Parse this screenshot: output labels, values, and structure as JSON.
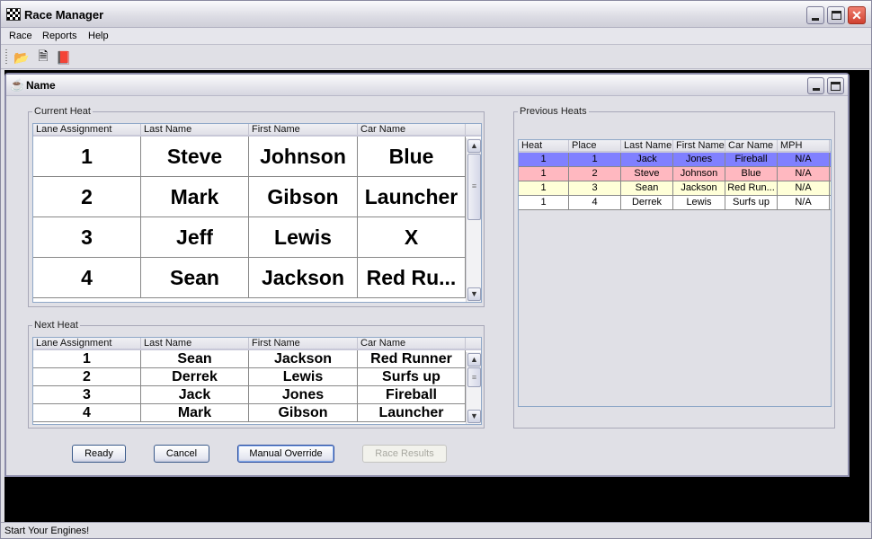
{
  "app": {
    "title": "Race Manager",
    "menu": [
      "Race",
      "Reports",
      "Help"
    ],
    "toolbar": [
      {
        "name": "open-icon",
        "glyph": "📂"
      },
      {
        "name": "export-icon",
        "glyph": "🗎"
      },
      {
        "name": "help-book-icon",
        "glyph": "📕"
      }
    ],
    "status": "Start Your Engines!"
  },
  "inner_window": {
    "title": "Name"
  },
  "current_heat": {
    "label": "Current Heat",
    "columns": [
      "Lane Assignment",
      "Last Name",
      "First Name",
      "Car Name"
    ],
    "rows": [
      [
        "1",
        "Steve",
        "Johnson",
        "Blue"
      ],
      [
        "2",
        "Mark",
        "Gibson",
        "Launcher"
      ],
      [
        "3",
        "Jeff",
        "Lewis",
        "X"
      ],
      [
        "4",
        "Sean",
        "Jackson",
        "Red Ru..."
      ]
    ]
  },
  "next_heat": {
    "label": "Next Heat",
    "columns": [
      "Lane Assignment",
      "Last Name",
      "First Name",
      "Car Name"
    ],
    "rows": [
      [
        "1",
        "Sean",
        "Jackson",
        "Red Runner"
      ],
      [
        "2",
        "Derrek",
        "Lewis",
        "Surfs up"
      ],
      [
        "3",
        "Jack",
        "Jones",
        "Fireball"
      ],
      [
        "4",
        "Mark",
        "Gibson",
        "Launcher"
      ]
    ]
  },
  "previous_heats": {
    "label": "Previous Heats",
    "columns": [
      "Heat",
      "Place",
      "Last Name",
      "First Name",
      "Car Name",
      "MPH"
    ],
    "rows": [
      {
        "cells": [
          "1",
          "1",
          "Jack",
          "Jones",
          "Fireball",
          "N/A"
        ],
        "color": "#8080ff"
      },
      {
        "cells": [
          "1",
          "2",
          "Steve",
          "Johnson",
          "Blue",
          "N/A"
        ],
        "color": "#ffb8c0"
      },
      {
        "cells": [
          "1",
          "3",
          "Sean",
          "Jackson",
          "Red Run...",
          "N/A"
        ],
        "color": "#ffffd8"
      },
      {
        "cells": [
          "1",
          "4",
          "Derrek",
          "Lewis",
          "Surfs up",
          "N/A"
        ],
        "color": "#ffffff"
      }
    ]
  },
  "buttons": {
    "ready": "Ready",
    "cancel": "Cancel",
    "manual_override": "Manual Override",
    "race_results": "Race Results"
  }
}
